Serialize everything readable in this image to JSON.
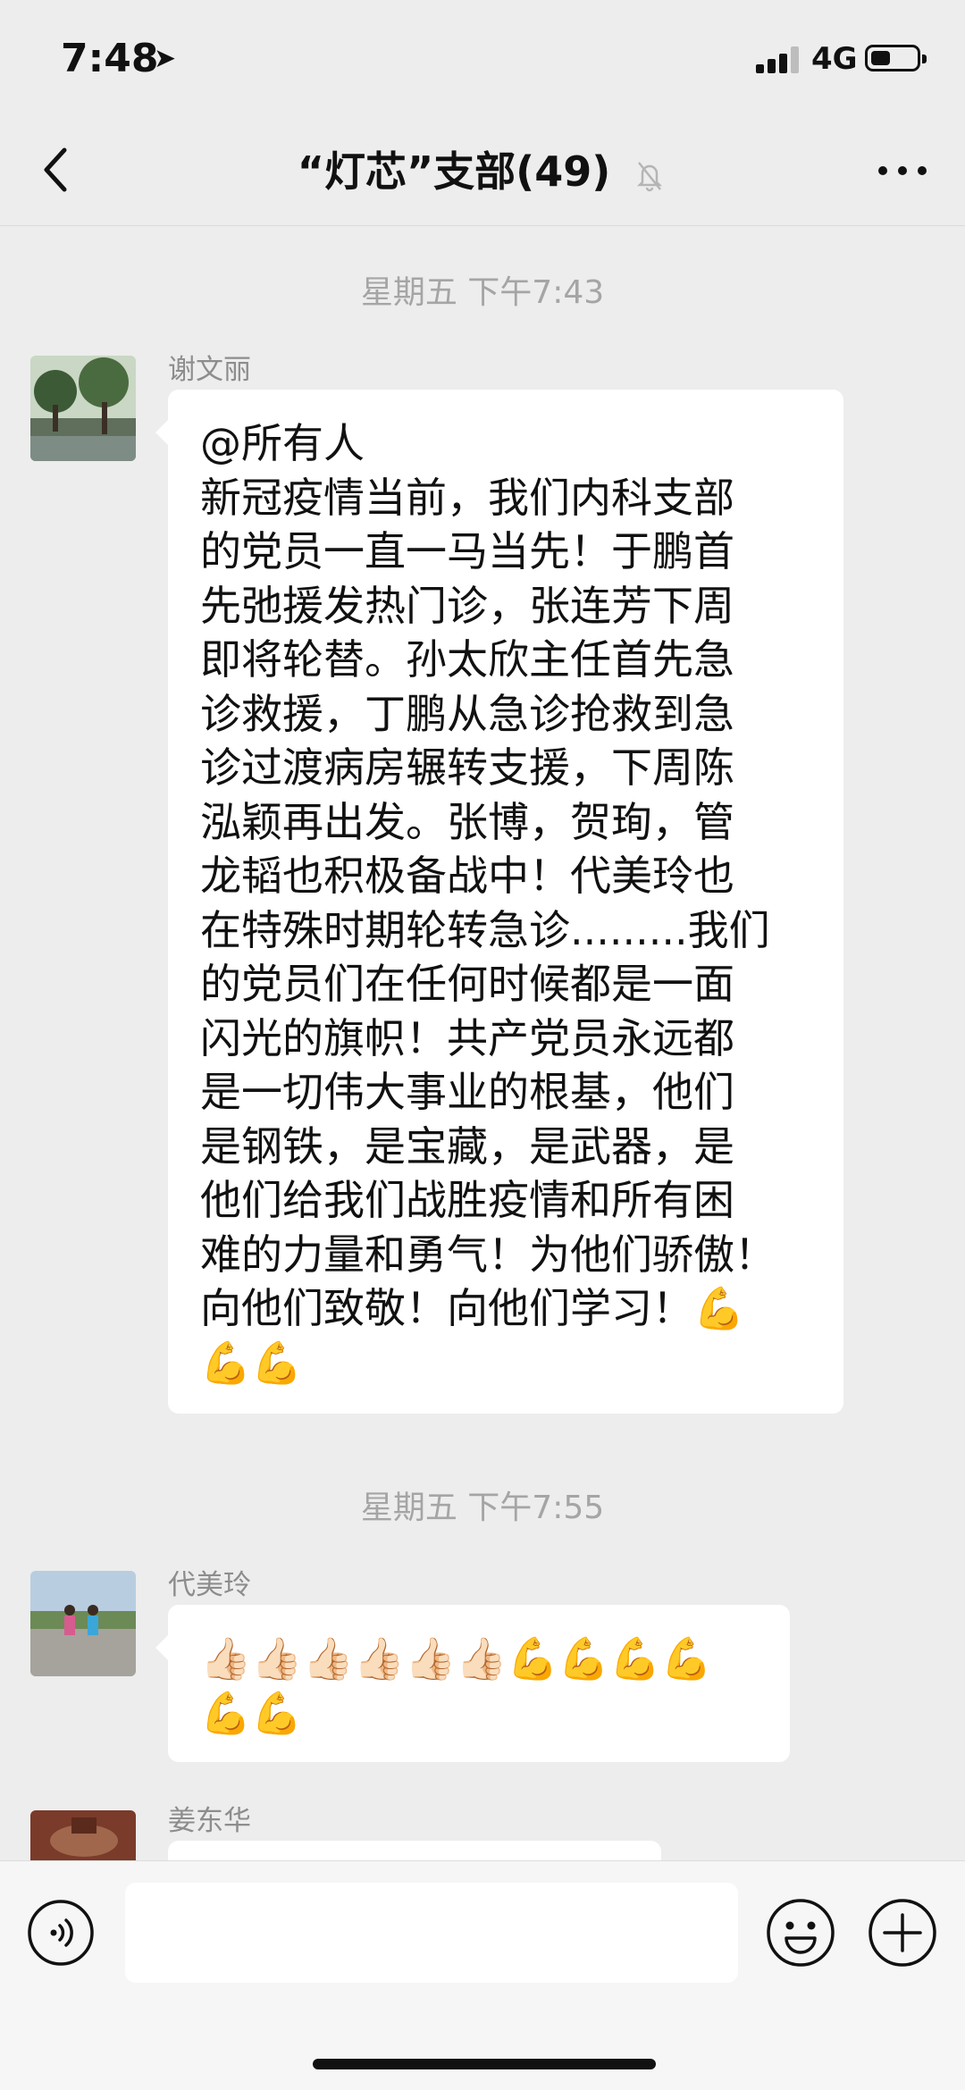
{
  "status_bar": {
    "time": "7:48",
    "network": "4G",
    "battery_level": 0.44
  },
  "nav": {
    "title": "“灯芯”支部(49)"
  },
  "messages": [
    {
      "timestamp": "星期五 下午7:43",
      "sender": "谢文丽",
      "text": "@所有人\n新冠疫情当前，我们内科支部\n的党员一直一马当先！于鹏首\n先弛援发热门诊，张连芳下周\n即将轮替。孙太欣主任首先急\n诊救援，丁鹏从急诊抢救到急\n诊过渡病房辗转支援，下周陈\n泓颖再出发。张博，贺珣，管\n龙韬也积极备战中！代美玲也\n在特殊时期轮转急诊.........我们\n的党员们在任何时候都是一面\n闪光的旗帜！共产党员永远都\n是一切伟大事业的根基，他们\n是钢铁，是宝藏，是武器，是\n他们给我们战胜疫情和所有困\n难的力量和勇气！为他们骄傲！\n向他们致敬！向他们学习！💪\n💪💪"
    },
    {
      "timestamp": "星期五 下午7:55",
      "sender": "代美玲",
      "text": "👍🏻👍🏻👍🏻👍🏻👍🏻👍🏻💪💪💪💪\n💪💪"
    },
    {
      "sender": "姜东华"
    }
  ],
  "icons": {
    "back": "chevron-left-icon",
    "mute": "bell-off-icon",
    "more": "more-dots-icon",
    "voice": "voice-icon",
    "emoji": "emoji-icon",
    "plus": "plus-icon"
  }
}
